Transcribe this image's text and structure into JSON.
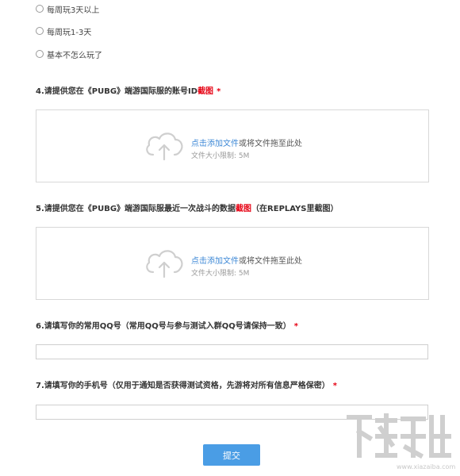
{
  "radio_options": [
    {
      "label": "每周玩3天以上"
    },
    {
      "label": "每周玩1-3天"
    },
    {
      "label": "基本不怎么玩了"
    }
  ],
  "questions": {
    "q4": {
      "text": "4.请提供您在《PUBG》端游国际服的账号ID",
      "red": "截图",
      "suffix": "",
      "required": "*"
    },
    "q5": {
      "text": "5.请提供您在《PUBG》端游国际服最近一次战斗的数据",
      "red": "截图",
      "suffix": "（在REPLAYS里截图）",
      "required": ""
    },
    "q6": {
      "text": "6.请填写你的常用QQ号（常用QQ号与参与测试入群QQ号请保持一致）",
      "required": "*"
    },
    "q7": {
      "text": "7.请填写你的手机号（仅用于通知是否获得测试资格，先游将对所有信息严格保密）",
      "required": "*"
    }
  },
  "upload": {
    "link_text": "点击添加文件",
    "rest_text": "或将文件拖至此处",
    "limit_text": "文件大小限制: 5M"
  },
  "inputs": {
    "qq_value": "",
    "phone_value": ""
  },
  "submit_label": "提交",
  "watermark": {
    "site": "www.xiazaiba.com"
  },
  "colors": {
    "accent": "#4a9de5",
    "link": "#3d88d6",
    "required": "#e60012"
  }
}
